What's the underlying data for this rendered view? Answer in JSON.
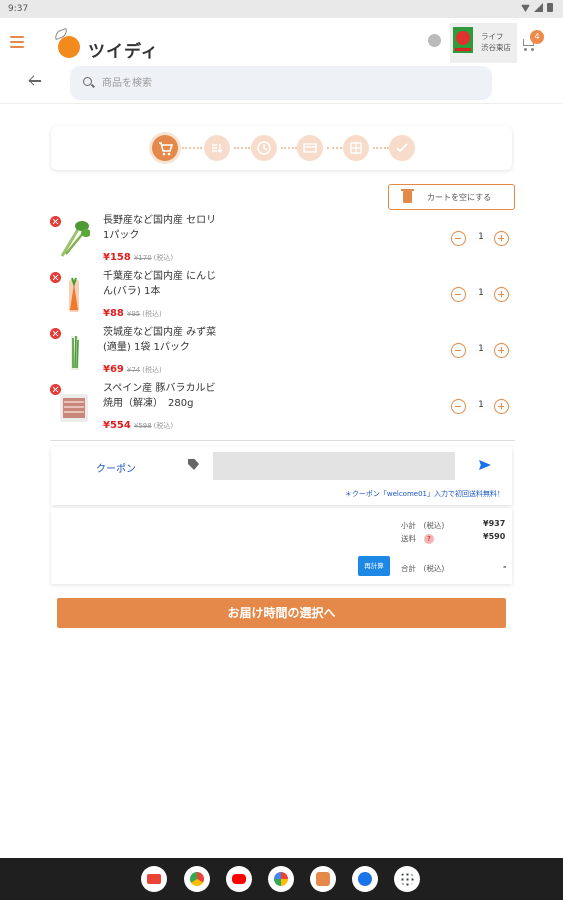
{
  "status_bar": {
    "time": "9:37"
  },
  "header": {
    "brand": "ツイディ",
    "store_name_line1": "ライフ",
    "store_name_line2": "渋谷東店",
    "cart_count": "4"
  },
  "search": {
    "placeholder": "商品を検索"
  },
  "steps": {
    "icons": [
      "cart-icon",
      "list-icon",
      "clock-icon",
      "card-icon",
      "checklist-icon",
      "check-icon"
    ]
  },
  "cart": {
    "empty_cart_label": "カートを空にする",
    "items": [
      {
        "name": "長野産など国内産 セロリ 1パック",
        "price": "¥158",
        "original": "¥170",
        "tax": "(税込)",
        "qty": "1"
      },
      {
        "name": "千葉産など国内産 にんじん(バラ) 1本",
        "price": "¥88",
        "original": "¥95",
        "tax": "(税込)",
        "qty": "1"
      },
      {
        "name": "茨城産など国内産 みず菜(適量) 1袋 1パック",
        "price": "¥69",
        "original": "¥74",
        "tax": "(税込)",
        "qty": "1"
      },
      {
        "name": "スペイン産 豚バラカルビ焼用（解凍）　280g",
        "price": "¥554",
        "original": "¥598",
        "tax": "(税込)",
        "qty": "1"
      }
    ]
  },
  "coupon": {
    "label": "クーポン",
    "hint": "＊クーポン「welcome01」入力で初回送料無料！"
  },
  "summary": {
    "subtotal_label": "小計",
    "subtotal_tax": "(税込)",
    "subtotal_value": "¥937",
    "shipping_label": "送料",
    "shipping_help": "?",
    "shipping_value": "¥590",
    "recalc_label": "再計算",
    "total_label": "合計",
    "total_tax": "(税込)",
    "total_value": "-"
  },
  "proceed_button": "お届け時間の選択へ",
  "navbar": {
    "apps": [
      "gmail",
      "chrome",
      "youtube",
      "photos",
      "app-orange",
      "messages",
      "app-drawer"
    ],
    "colors": [
      "#ea4335",
      "#4285f4",
      "#ff0000",
      "#fbbc04",
      "#e5894a",
      "#1a73e8",
      "#3c4043"
    ]
  },
  "colors": {
    "accent": "#e5894a",
    "price": "#e02020",
    "link": "#1a56c5"
  }
}
